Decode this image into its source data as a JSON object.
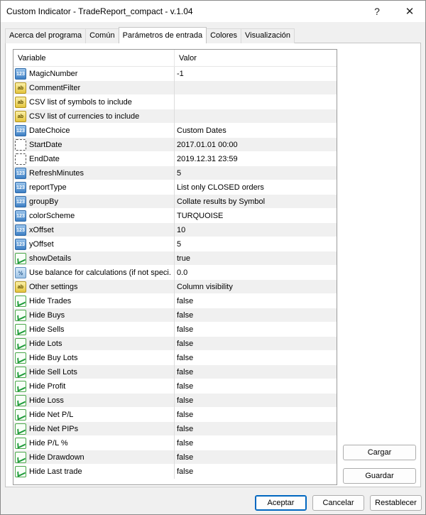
{
  "window": {
    "title": "Custom Indicator - TradeReport_compact - v.1.04",
    "help_label": "?",
    "close_label": "✕"
  },
  "tabs": [
    {
      "label": "Acerca del programa"
    },
    {
      "label": "Común"
    },
    {
      "label": "Parámetros de entrada",
      "active": true
    },
    {
      "label": "Colores"
    },
    {
      "label": "Visualización"
    }
  ],
  "table": {
    "headers": {
      "variable": "Variable",
      "value": "Valor"
    },
    "rows": [
      {
        "icon": "int-icon",
        "icon_text": "123",
        "name": "MagicNumber",
        "value": "-1"
      },
      {
        "icon": "string-icon",
        "icon_text": "ab",
        "name": "CommentFilter",
        "value": ""
      },
      {
        "icon": "string-icon",
        "icon_text": "ab",
        "name": "CSV list of symbols to include",
        "value": ""
      },
      {
        "icon": "string-icon",
        "icon_text": "ab",
        "name": "CSV list of currencies to include",
        "value": ""
      },
      {
        "icon": "int-icon",
        "icon_text": "123",
        "name": "DateChoice",
        "value": "Custom Dates"
      },
      {
        "icon": "date-icon",
        "icon_text": "",
        "name": "StartDate",
        "value": "2017.01.01 00:00"
      },
      {
        "icon": "date-icon",
        "icon_text": "",
        "name": "EndDate",
        "value": "2019.12.31 23:59"
      },
      {
        "icon": "int-icon",
        "icon_text": "123",
        "name": "RefreshMinutes",
        "value": "5"
      },
      {
        "icon": "int-icon",
        "icon_text": "123",
        "name": "reportType",
        "value": "List only CLOSED orders"
      },
      {
        "icon": "int-icon",
        "icon_text": "123",
        "name": "groupBy",
        "value": "Collate results by Symbol"
      },
      {
        "icon": "int-icon",
        "icon_text": "123",
        "name": "colorScheme",
        "value": "TURQUOISE"
      },
      {
        "icon": "int-icon",
        "icon_text": "123",
        "name": "xOffset",
        "value": "10"
      },
      {
        "icon": "int-icon",
        "icon_text": "123",
        "name": "yOffset",
        "value": "5"
      },
      {
        "icon": "bool-icon",
        "icon_text": "",
        "name": "showDetails",
        "value": "true"
      },
      {
        "icon": "double-icon",
        "icon_text": "½",
        "name": "Use balance for calculations (if not speci...",
        "value": "0.0"
      },
      {
        "icon": "string-icon",
        "icon_text": "ab",
        "name": "Other settings",
        "value": "Column visibility"
      },
      {
        "icon": "bool-icon",
        "icon_text": "",
        "name": "Hide Trades",
        "value": "false"
      },
      {
        "icon": "bool-icon",
        "icon_text": "",
        "name": "Hide Buys",
        "value": "false"
      },
      {
        "icon": "bool-icon",
        "icon_text": "",
        "name": "Hide Sells",
        "value": "false"
      },
      {
        "icon": "bool-icon",
        "icon_text": "",
        "name": "Hide Lots",
        "value": "false"
      },
      {
        "icon": "bool-icon",
        "icon_text": "",
        "name": "Hide Buy Lots",
        "value": "false"
      },
      {
        "icon": "bool-icon",
        "icon_text": "",
        "name": "Hide Sell Lots",
        "value": "false"
      },
      {
        "icon": "bool-icon",
        "icon_text": "",
        "name": "Hide Profit",
        "value": "false"
      },
      {
        "icon": "bool-icon",
        "icon_text": "",
        "name": "Hide Loss",
        "value": "false"
      },
      {
        "icon": "bool-icon",
        "icon_text": "",
        "name": "Hide Net P/L",
        "value": "false"
      },
      {
        "icon": "bool-icon",
        "icon_text": "",
        "name": "Hide Net PIPs",
        "value": "false"
      },
      {
        "icon": "bool-icon",
        "icon_text": "",
        "name": "Hide P/L %",
        "value": "false"
      },
      {
        "icon": "bool-icon",
        "icon_text": "",
        "name": "Hide Drawdown",
        "value": "false"
      },
      {
        "icon": "bool-icon",
        "icon_text": "",
        "name": "Hide Last trade",
        "value": "false"
      }
    ]
  },
  "side_buttons": {
    "load": "Cargar",
    "save": "Guardar"
  },
  "footer_buttons": {
    "ok": "Aceptar",
    "cancel": "Cancelar",
    "reset": "Restablecer"
  },
  "colors": {
    "accent": "#0067c0",
    "row_alt": "#f0f0f0"
  }
}
